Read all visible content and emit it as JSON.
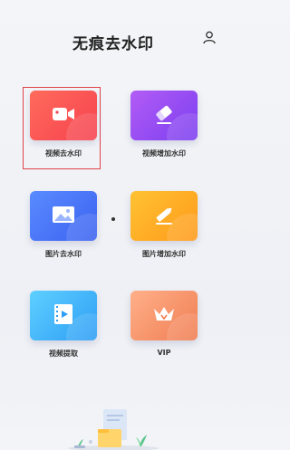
{
  "header": {
    "title": "无痕去水印"
  },
  "items": [
    {
      "label": "视频去水印",
      "icon": "video-camera-icon",
      "gradient": [
        "#ff6b5b",
        "#f6414f"
      ]
    },
    {
      "label": "视频增加水印",
      "icon": "eraser-icon",
      "gradient": [
        "#b35cf5",
        "#7b3ff0"
      ]
    },
    {
      "label": "图片去水印",
      "icon": "picture-icon",
      "gradient": [
        "#5a8bff",
        "#3b62f0"
      ]
    },
    {
      "label": "图片增加水印",
      "icon": "pencil-icon",
      "gradient": [
        "#ffc233",
        "#ff9a1a"
      ]
    },
    {
      "label": "视频提取",
      "icon": "film-icon",
      "gradient": [
        "#5fd0ff",
        "#2d9df5"
      ]
    },
    {
      "label": "VIP",
      "icon": "crown-icon",
      "gradient": [
        "#ffb08a",
        "#f07d52"
      ]
    }
  ],
  "selected_item": "视频去水印"
}
